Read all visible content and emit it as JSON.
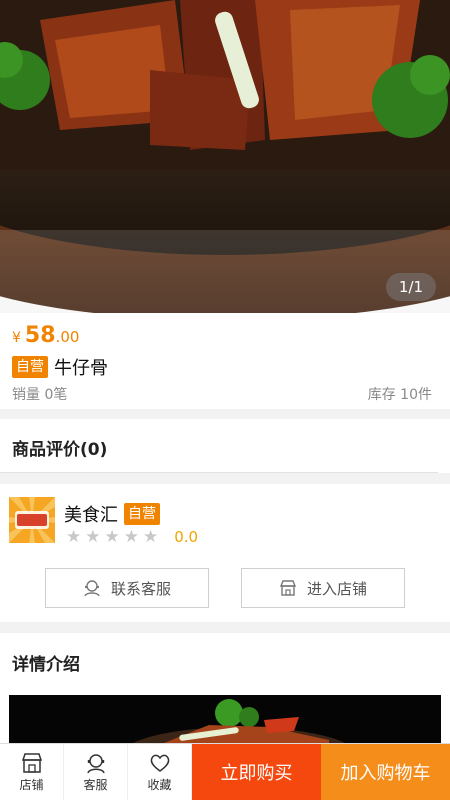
{
  "gallery": {
    "indicator": "1/1"
  },
  "product": {
    "currency": "¥",
    "price_int": "58",
    "price_dec": ".00",
    "self_badge": "自营",
    "name": "牛仔骨",
    "sales": "销量 0笔",
    "stock": "库存 10件"
  },
  "review": {
    "label": "商品评价(0)"
  },
  "store": {
    "name": "美食汇",
    "badge": "自营",
    "stars": [
      "★",
      "★",
      "★",
      "★",
      "★"
    ],
    "rating": "0.0",
    "contact_label": "联系客服",
    "enter_label": "进入店铺"
  },
  "detail": {
    "label": "详情介绍"
  },
  "bottom": {
    "shop_label": "店铺",
    "service_label": "客服",
    "favorite_label": "收藏",
    "buy_label": "立即购买",
    "cart_label": "加入购物车"
  },
  "colors": {
    "accent": "#f08300",
    "buy": "#f5480f",
    "cart": "#f58d1a",
    "rating": "#f0a500"
  },
  "icons": [
    "service-icon",
    "store-icon",
    "heart-icon"
  ]
}
